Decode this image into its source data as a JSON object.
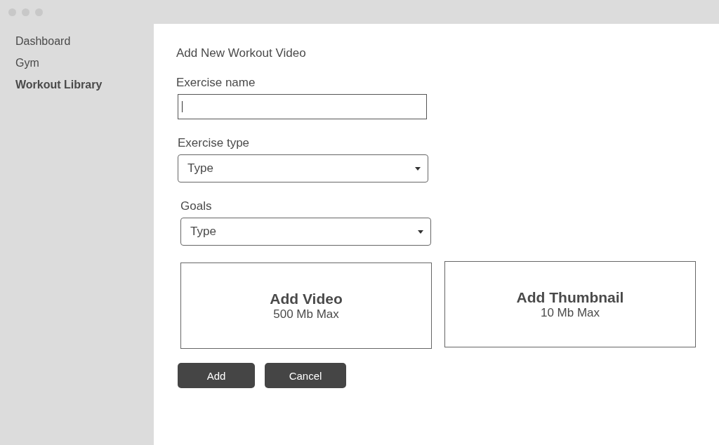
{
  "sidebar": {
    "items": [
      {
        "label": "Dashboard",
        "selected": false
      },
      {
        "label": "Gym",
        "selected": false
      },
      {
        "label": "Workout Library",
        "selected": true
      }
    ]
  },
  "form": {
    "title": "Add New Workout Video",
    "fields": [
      {
        "kind": "text",
        "label": "Exercise name",
        "focused": true
      },
      {
        "kind": "select",
        "label": "Exercise type",
        "value": "Type"
      },
      {
        "kind": "select",
        "label": "Goals",
        "value": "Type"
      }
    ],
    "uploads": [
      {
        "title": "Add Video",
        "limit": "500 Mb Max"
      },
      {
        "title": "Add Thumbnail",
        "limit": "10 Mb Max"
      }
    ],
    "buttons": [
      "Add",
      "Cancel"
    ]
  }
}
